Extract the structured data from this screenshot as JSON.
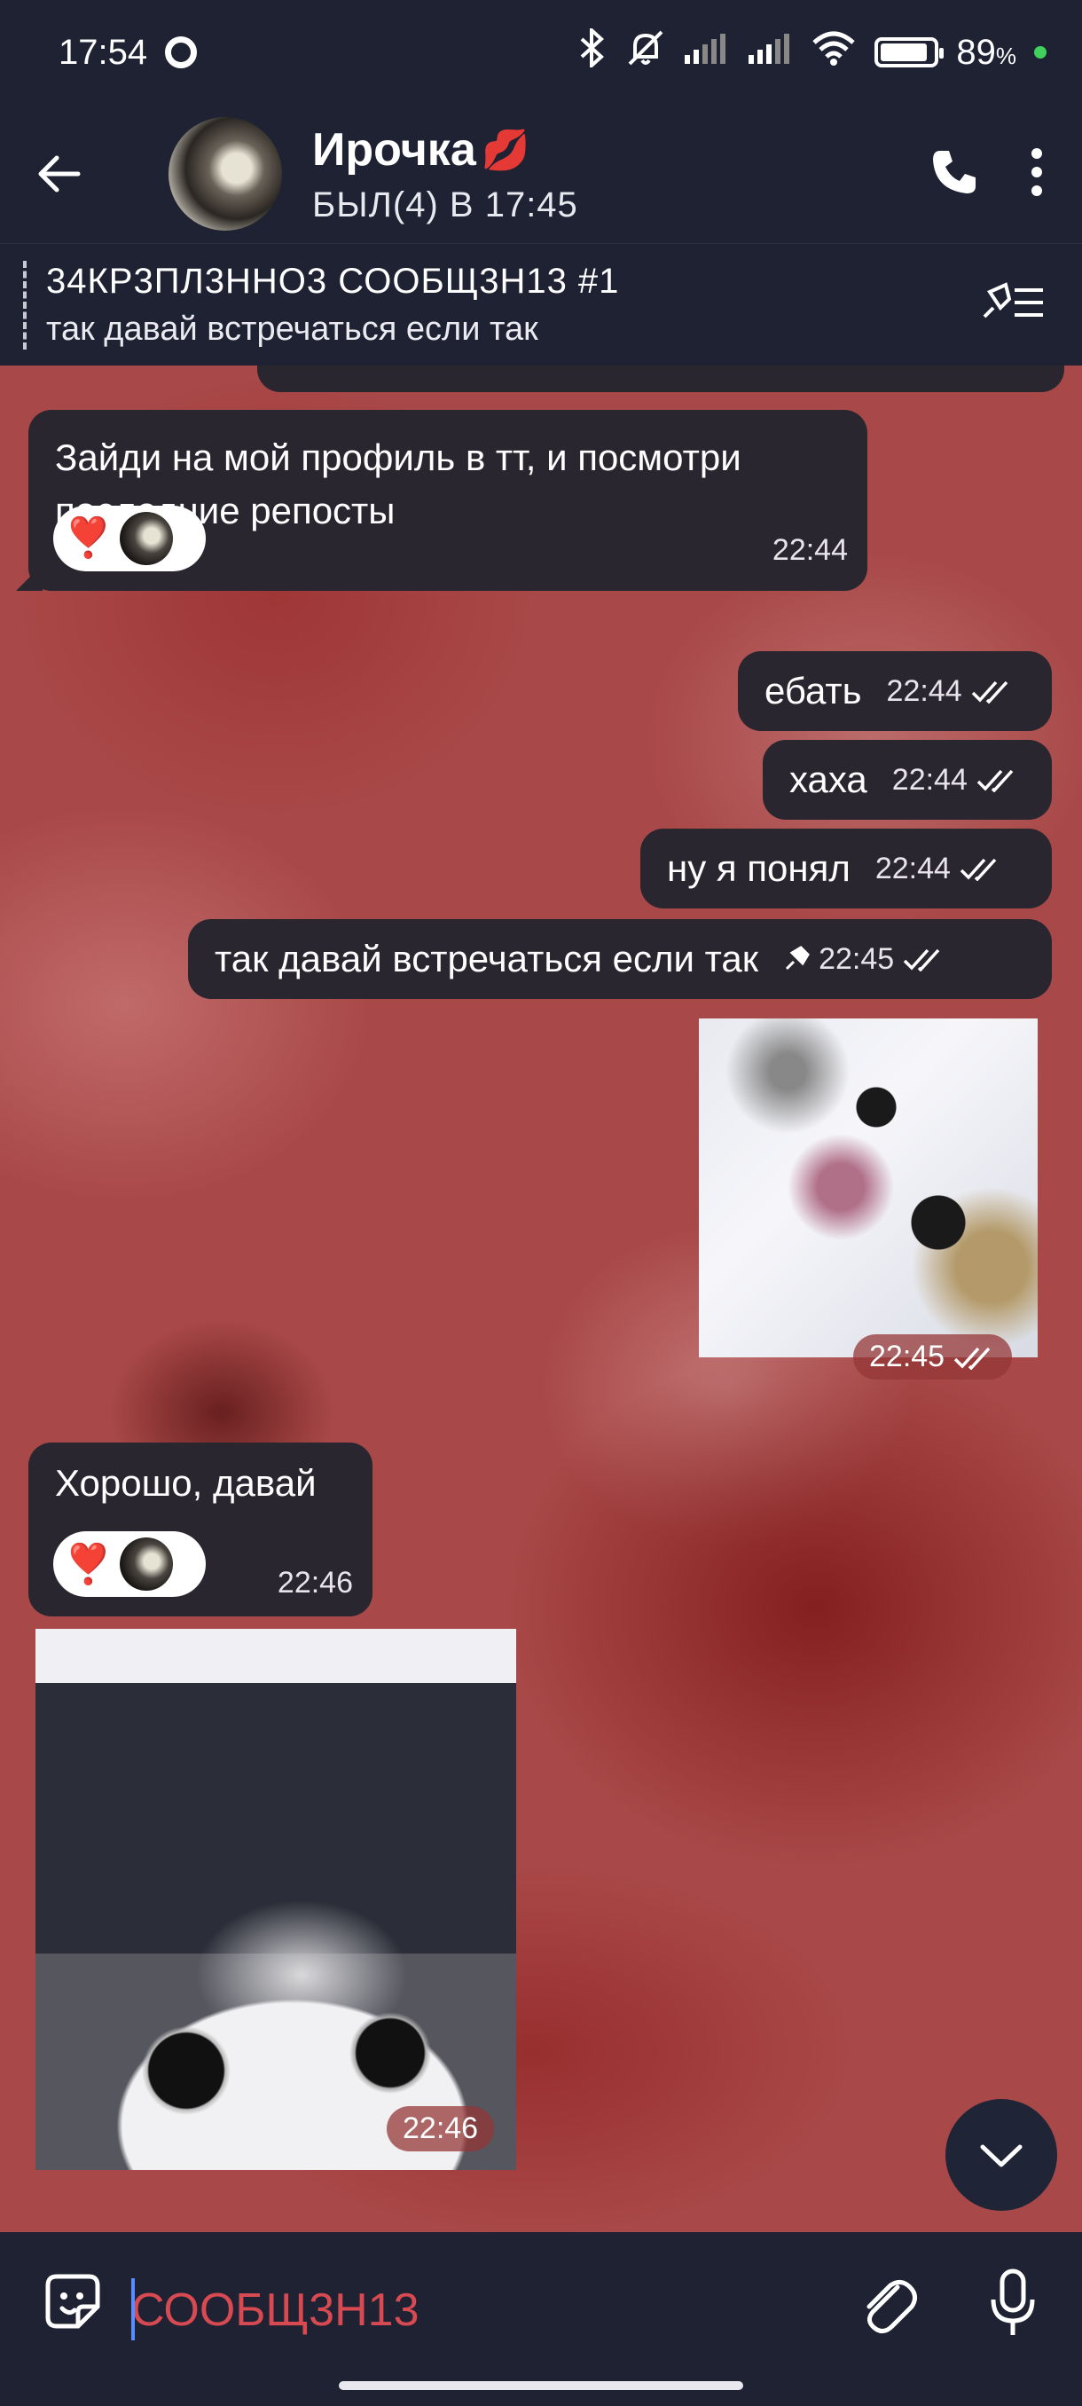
{
  "status_bar": {
    "time": "17:54",
    "battery_percent": "89",
    "battery_unit": "%",
    "battery_level": 0.89,
    "icons": [
      "bluetooth-icon",
      "mute-bell-icon",
      "signal-icon",
      "signal-icon",
      "wifi-icon",
      "battery-icon"
    ]
  },
  "header": {
    "name": "Ирочка",
    "emoji": "💋",
    "last_seen": "БЫЛ(4) В 17:45"
  },
  "pinned": {
    "title": "34КР3ПЛ3ННО3 СООБЩ3Н13 #1",
    "text": "так давай встречаться если так"
  },
  "messages": [
    {
      "direction": "in",
      "text": "Зайди на мой профиль в тт, и посмотри последние репосты",
      "time": "22:44",
      "reactions": [
        "❣️"
      ]
    },
    {
      "direction": "out",
      "text": "ебать",
      "time": "22:44",
      "status": "read"
    },
    {
      "direction": "out",
      "text": "хаха",
      "time": "22:44",
      "status": "read"
    },
    {
      "direction": "out",
      "text": "ну я понял",
      "time": "22:44",
      "status": "read"
    },
    {
      "direction": "out",
      "text": "так давай встречаться если так",
      "time": "22:45",
      "status": "read",
      "pinned": true
    },
    {
      "direction": "out",
      "type": "sticker",
      "time": "22:45",
      "status": "read"
    },
    {
      "direction": "in",
      "text": "Хорошо, давай",
      "time": "22:46",
      "reactions": [
        "❣️"
      ]
    },
    {
      "direction": "in",
      "type": "sticker",
      "time": "22:46"
    }
  ],
  "composer": {
    "placeholder": "СООБЩ3Н13"
  },
  "colors": {
    "bar_bg": "#1e2232",
    "bubble_bg": "#2a2630",
    "chat_bg": "#a94848",
    "placeholder": "#d84a52",
    "caret": "#5b8cff"
  }
}
